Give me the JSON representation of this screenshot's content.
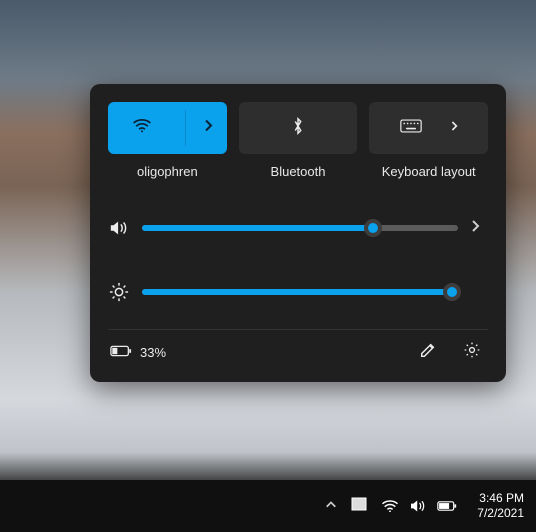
{
  "panel": {
    "tiles": {
      "wifi": {
        "label": "oligophren",
        "active": true
      },
      "bt": {
        "label": "Bluetooth",
        "active": false
      },
      "kbd": {
        "label": "Keyboard layout",
        "active": false
      }
    },
    "volume_percent": 73,
    "brightness_percent": 98,
    "battery_text": "33%"
  },
  "taskbar": {
    "time": "3:46 PM",
    "date": "7/2/2021"
  },
  "colors": {
    "accent": "#0aa2ed",
    "panel_bg": "#1f1f1f",
    "tile_off": "#2e2e2e"
  }
}
